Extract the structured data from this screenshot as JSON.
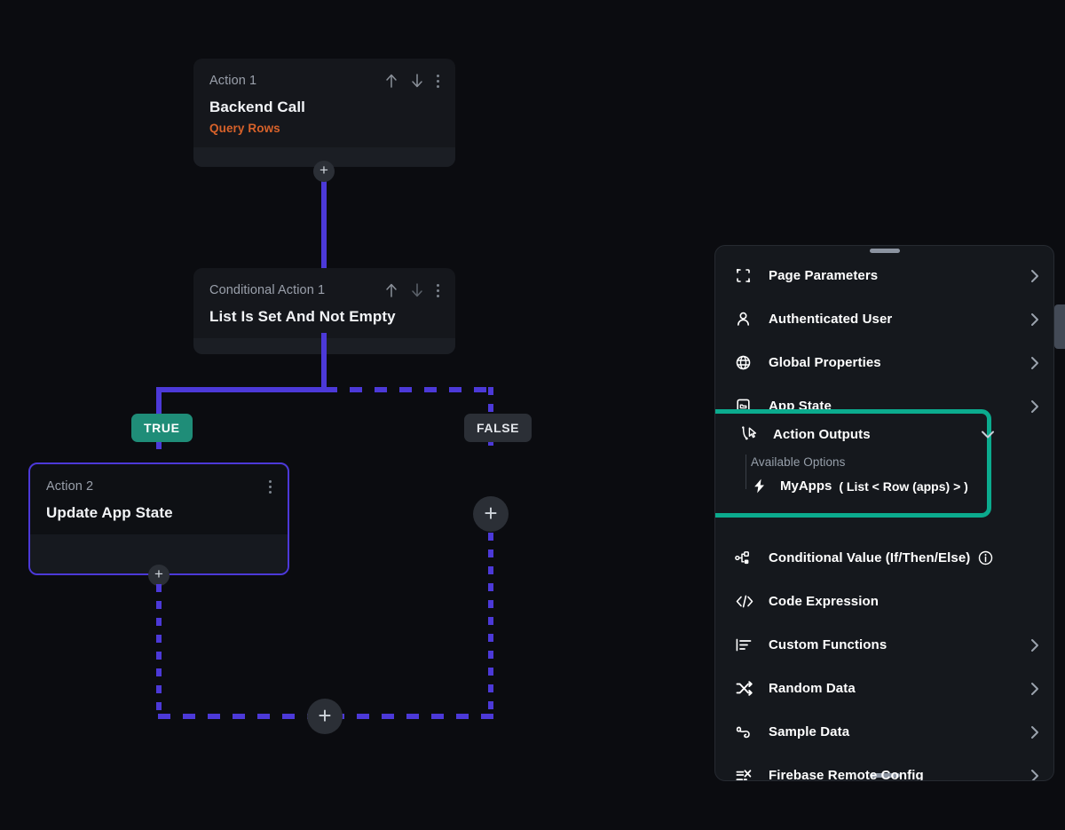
{
  "theme": {
    "page_bg": "#0b0c10",
    "card_bg": "#15171c",
    "wire_purple": "#4c39d8",
    "accent_teal": "#0bab8e",
    "true_badge": "#1f8d78",
    "orange_text": "#d8622a"
  },
  "flow": {
    "nodes": [
      {
        "label": "Action 1",
        "title": "Backend Call",
        "subtitle": "Query Rows",
        "has_up_arrow": true,
        "has_down_arrow": true,
        "has_menu": true
      },
      {
        "label": "Conditional Action 1",
        "title": "List Is Set And Not Empty",
        "subtitle": "",
        "has_up_arrow": true,
        "has_down_arrow": true,
        "has_menu": true
      },
      {
        "label": "Action 2",
        "title": "Update App State",
        "subtitle": "",
        "has_up_arrow": false,
        "has_down_arrow": false,
        "has_menu": true
      }
    ],
    "branches": {
      "true_label": "TRUE",
      "false_label": "FALSE"
    },
    "add_buttons": [
      "add-step-after-action-1",
      "add-step-after-action-2",
      "add-step-false-branch",
      "add-step-merge"
    ],
    "plus_glyph": "+"
  },
  "panel": {
    "items": [
      {
        "label": "Page Parameters",
        "icon": "page-parameters-icon",
        "chevron": "right",
        "info": false
      },
      {
        "label": "Authenticated User",
        "icon": "user-icon",
        "chevron": "right",
        "info": false
      },
      {
        "label": "Global Properties",
        "icon": "globe-icon",
        "chevron": "right",
        "info": false
      },
      {
        "label": "App State",
        "icon": "app-state-icon",
        "chevron": "right",
        "info": false
      },
      {
        "label": "Action Outputs",
        "icon": "action-outputs-icon",
        "chevron": "down",
        "info": false,
        "highlighted": true
      },
      {
        "label": "Conditional Value (If/Then/Else)",
        "icon": "conditional-value-icon",
        "chevron": "none",
        "info": true
      },
      {
        "label": "Code Expression",
        "icon": "code-icon",
        "chevron": "none",
        "info": false
      },
      {
        "label": "Custom Functions",
        "icon": "custom-functions-icon",
        "chevron": "right",
        "info": false
      },
      {
        "label": "Random Data",
        "icon": "shuffle-icon",
        "chevron": "right",
        "info": false
      },
      {
        "label": "Sample Data",
        "icon": "sample-data-icon",
        "chevron": "right",
        "info": false
      },
      {
        "label": "Firebase Remote Config",
        "icon": "firebase-config-icon",
        "chevron": "right",
        "info": false
      }
    ],
    "action_outputs": {
      "title": "Action Outputs",
      "available_options_label": "Available Options",
      "options": [
        {
          "name": "MyApps",
          "type": "( List < Row (apps) > )",
          "icon": "bolt-icon"
        }
      ]
    }
  }
}
